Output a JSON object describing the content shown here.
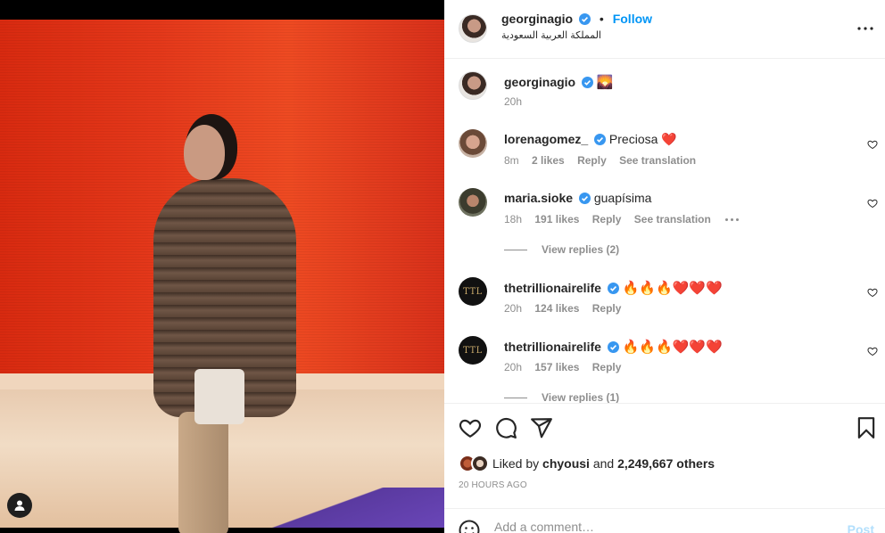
{
  "post": {
    "username": "georginagio",
    "follow_label": "Follow",
    "location": "المملكة العربية السعودية"
  },
  "caption": {
    "username": "georginagio",
    "emoji": "🌄",
    "time": "20h"
  },
  "comments": [
    {
      "username": "lorenagomez_",
      "text": "Preciosa ❤️",
      "time": "8m",
      "likes": "2 likes",
      "reply": "Reply",
      "translate": "See translation"
    },
    {
      "username": "maria.sioke",
      "text": "guapísima",
      "time": "18h",
      "likes": "191 likes",
      "reply": "Reply",
      "translate": "See translation",
      "view_replies": "View replies (2)"
    },
    {
      "username": "thetrillionairelife",
      "text": "🔥🔥🔥❤️❤️❤️",
      "time": "20h",
      "likes": "124 likes",
      "reply": "Reply",
      "avatar_text": "TTL"
    },
    {
      "username": "thetrillionairelife",
      "text": "🔥🔥🔥❤️❤️❤️",
      "time": "20h",
      "likes": "157 likes",
      "reply": "Reply",
      "avatar_text": "TTL",
      "view_replies": "View replies (1)"
    }
  ],
  "likes": {
    "prefix": "Liked by",
    "first_user": "chyousi",
    "joiner": "and",
    "count": "2,249,667 others"
  },
  "timestamp": "20 HOURS AGO",
  "add_comment": {
    "placeholder": "Add a comment…",
    "post_label": "Post"
  },
  "colors": {
    "accent": "#0095f6",
    "verified": "#3897f0",
    "muted": "#8e8e8e",
    "post_disabled": "#b2dffc"
  },
  "icons": [
    "more-icon",
    "verified-icon",
    "heart-icon",
    "comment-icon",
    "share-icon",
    "bookmark-icon",
    "smile-icon",
    "user-icon"
  ]
}
